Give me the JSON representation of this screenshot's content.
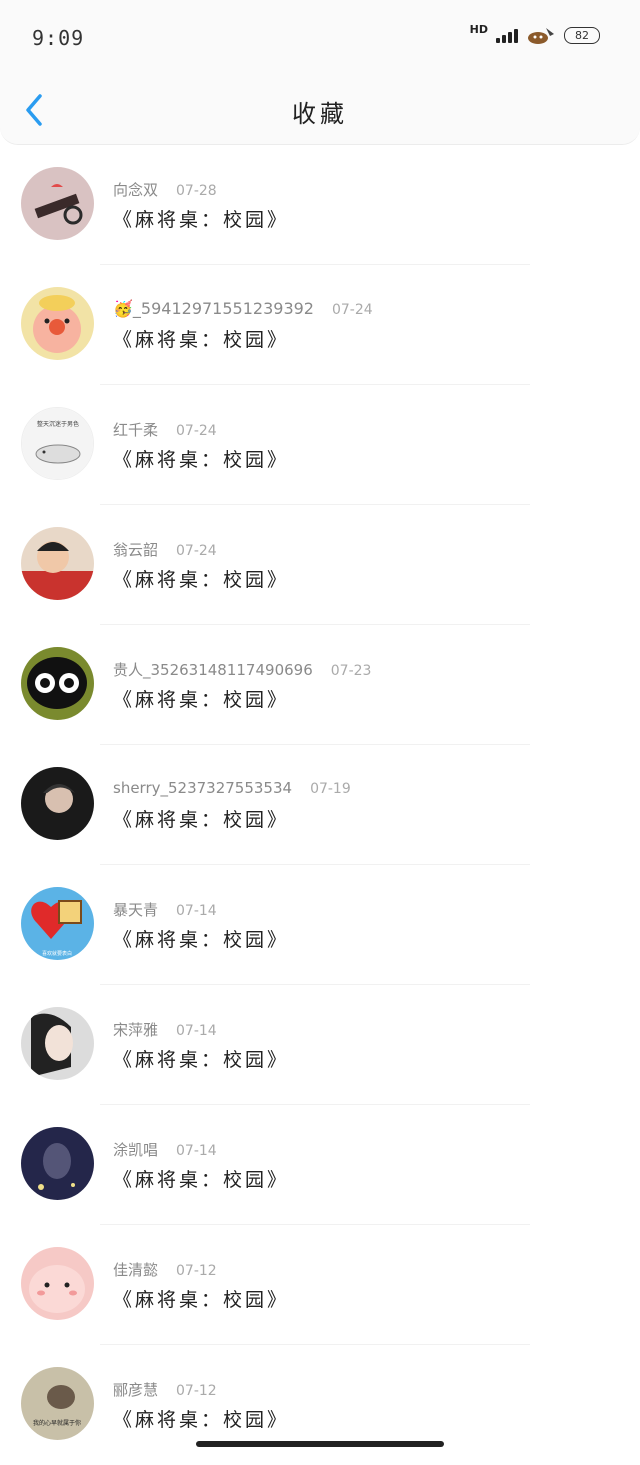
{
  "status_bar": {
    "time": "9:09",
    "network": "HD",
    "battery": "82"
  },
  "header": {
    "title": "收藏"
  },
  "favorites": [
    {
      "user": "向念双",
      "date": "07-28",
      "title": "《麻将桌：校园》",
      "avatar_color": "#d9c2c2"
    },
    {
      "user": "🥳_59412971551239392",
      "date": "07-24",
      "title": "《麻将桌：校园》",
      "avatar_color": "#f2e3a6"
    },
    {
      "user": "红千柔",
      "date": "07-24",
      "title": "《麻将桌：校园》",
      "avatar_color": "#f4f4f4"
    },
    {
      "user": "翁云韶",
      "date": "07-24",
      "title": "《麻将桌：校园》",
      "avatar_color": "#c9332e"
    },
    {
      "user": "贵人_35263148117490696",
      "date": "07-23",
      "title": "《麻将桌：校园》",
      "avatar_color": "#7a8a2e"
    },
    {
      "user": "sherry_5237327553534",
      "date": "07-19",
      "title": "《麻将桌：校园》",
      "avatar_color": "#1a1a1a"
    },
    {
      "user": "暴天青",
      "date": "07-14",
      "title": "《麻将桌：校园》",
      "avatar_color": "#5bb3e6"
    },
    {
      "user": "宋萍雅",
      "date": "07-14",
      "title": "《麻将桌：校园》",
      "avatar_color": "#dcdcdc"
    },
    {
      "user": "涂凯唱",
      "date": "07-14",
      "title": "《麻将桌：校园》",
      "avatar_color": "#24264a"
    },
    {
      "user": "佳清懿",
      "date": "07-12",
      "title": "《麻将桌：校园》",
      "avatar_color": "#f6c9c6"
    },
    {
      "user": "郦彦慧",
      "date": "07-12",
      "title": "《麻将桌：校园》",
      "avatar_color": "#c8c0a8"
    }
  ],
  "avatar_captions": {
    "item_2": "整天沉迷于男色",
    "item_6": "喜欢就要表白",
    "item_10": "我的心早就属于你"
  },
  "colors": {
    "accent": "#2a9cf0",
    "text_primary": "#222222",
    "text_secondary": "#8a8a8a"
  },
  "icons": {
    "back": "chevron-left-icon"
  }
}
